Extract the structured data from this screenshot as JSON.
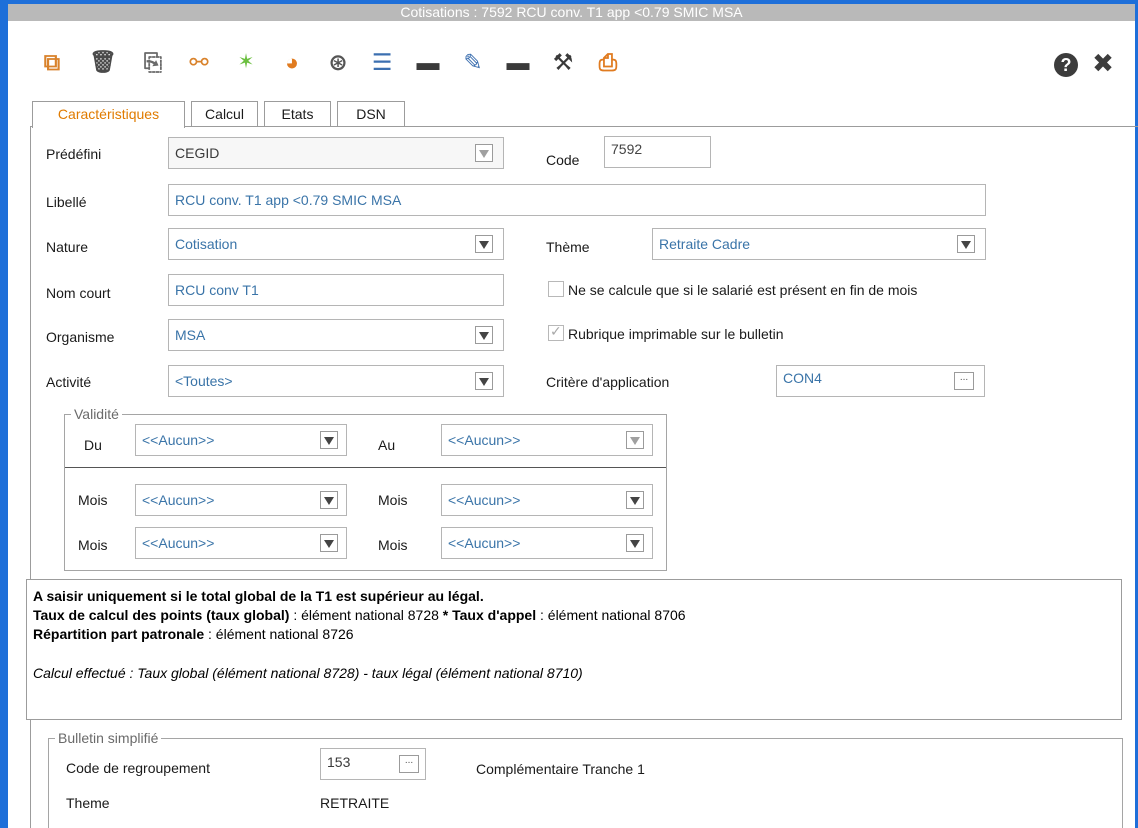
{
  "window": {
    "title": "Cotisations : 7592 RCU conv. T1 app <0.79 SMIC MSA",
    "accent_color": "#1e6fd9"
  },
  "toolbar": {
    "icons": [
      {
        "name": "new-document-icon",
        "glyph": "⧉",
        "color": "#d9822b"
      },
      {
        "name": "delete-icon",
        "glyph": "🗑",
        "color": "#4a4a4a"
      },
      {
        "name": "copy-icon",
        "glyph": "⎘",
        "color": "#6a6a6a"
      },
      {
        "name": "link-icon",
        "glyph": "⚯",
        "color": "#d9822b"
      },
      {
        "name": "wand-icon",
        "glyph": "✨",
        "color": "#6bbf3f"
      },
      {
        "name": "chart-icon",
        "glyph": "◕",
        "color": "#e07b20"
      },
      {
        "name": "globe-icon",
        "glyph": "⊛",
        "color": "#555555"
      },
      {
        "name": "list-icon",
        "glyph": "☰",
        "color": "#3c6fb0"
      },
      {
        "name": "folder-icon",
        "glyph": "▬",
        "color": "#3a3a3a"
      },
      {
        "name": "tools-icon",
        "glyph": "✎",
        "color": "#3c6fb0"
      },
      {
        "name": "open-folder-icon",
        "glyph": "▬",
        "color": "#3a3a3a"
      },
      {
        "name": "wrench-icon",
        "glyph": "⚒",
        "color": "#3a3a3a"
      },
      {
        "name": "printer-icon",
        "glyph": "⎙",
        "color": "#e07b20"
      }
    ],
    "help_glyph": "?",
    "close_glyph": "✖"
  },
  "tabs": [
    {
      "label": "Caractéristiques",
      "active": true
    },
    {
      "label": "Calcul",
      "active": false
    },
    {
      "label": "Etats",
      "active": false
    },
    {
      "label": "DSN",
      "active": false
    }
  ],
  "form": {
    "predefini": {
      "label": "Prédéfini",
      "value": "CEGID"
    },
    "code": {
      "label": "Code",
      "value": "7592"
    },
    "libelle": {
      "label": "Libellé",
      "value": "RCU conv. T1 app <0.79 SMIC MSA"
    },
    "nature": {
      "label": "Nature",
      "value": "Cotisation"
    },
    "theme": {
      "label": "Thème",
      "value": "Retraite Cadre"
    },
    "nom_court": {
      "label": "Nom court",
      "value": "RCU conv T1"
    },
    "fin_de_mois": {
      "label": "Ne se calcule que si le salarié est présent en fin de mois",
      "checked": false
    },
    "organisme": {
      "label": "Organisme",
      "value": "MSA"
    },
    "imprimable": {
      "label": "Rubrique imprimable sur le bulletin",
      "checked": true
    },
    "activite": {
      "label": "Activité",
      "value": "<Toutes>"
    },
    "critere": {
      "label": "Critère d'application",
      "value": "CON4",
      "button": "..."
    }
  },
  "validite": {
    "title": "Validité",
    "du": {
      "label": "Du",
      "value": "<<Aucun>>"
    },
    "au": {
      "label": "Au",
      "value": "<<Aucun>>"
    },
    "mois_rows": [
      {
        "left_label": "Mois",
        "left_value": "<<Aucun>>",
        "right_label": "Mois",
        "right_value": "<<Aucun>>"
      },
      {
        "left_label": "Mois",
        "left_value": "<<Aucun>>",
        "right_label": "Mois",
        "right_value": "<<Aucun>>"
      }
    ]
  },
  "memo": {
    "line1_bold": "A saisir uniquement si le total global de la T1 est supérieur au légal.",
    "line2_bold_a": "Taux de calcul des points (taux global)",
    "line2_text_a": " : élément national 8728 ",
    "line2_bold_b": "* Taux d'appel",
    "line2_text_b": " : élément national 8706",
    "line3_bold": "Répartition part patronale",
    "line3_text": " : élément national 8726",
    "line4_italic": "Calcul effectué : Taux global (élément national 8728) - taux légal (élément national 8710)"
  },
  "bulletin": {
    "title": "Bulletin simplifié",
    "code_label": "Code de regroupement",
    "code_value": "153",
    "code_button": "...",
    "code_desc": "Complémentaire Tranche 1",
    "theme_label": "Theme",
    "theme_value": "RETRAITE"
  }
}
